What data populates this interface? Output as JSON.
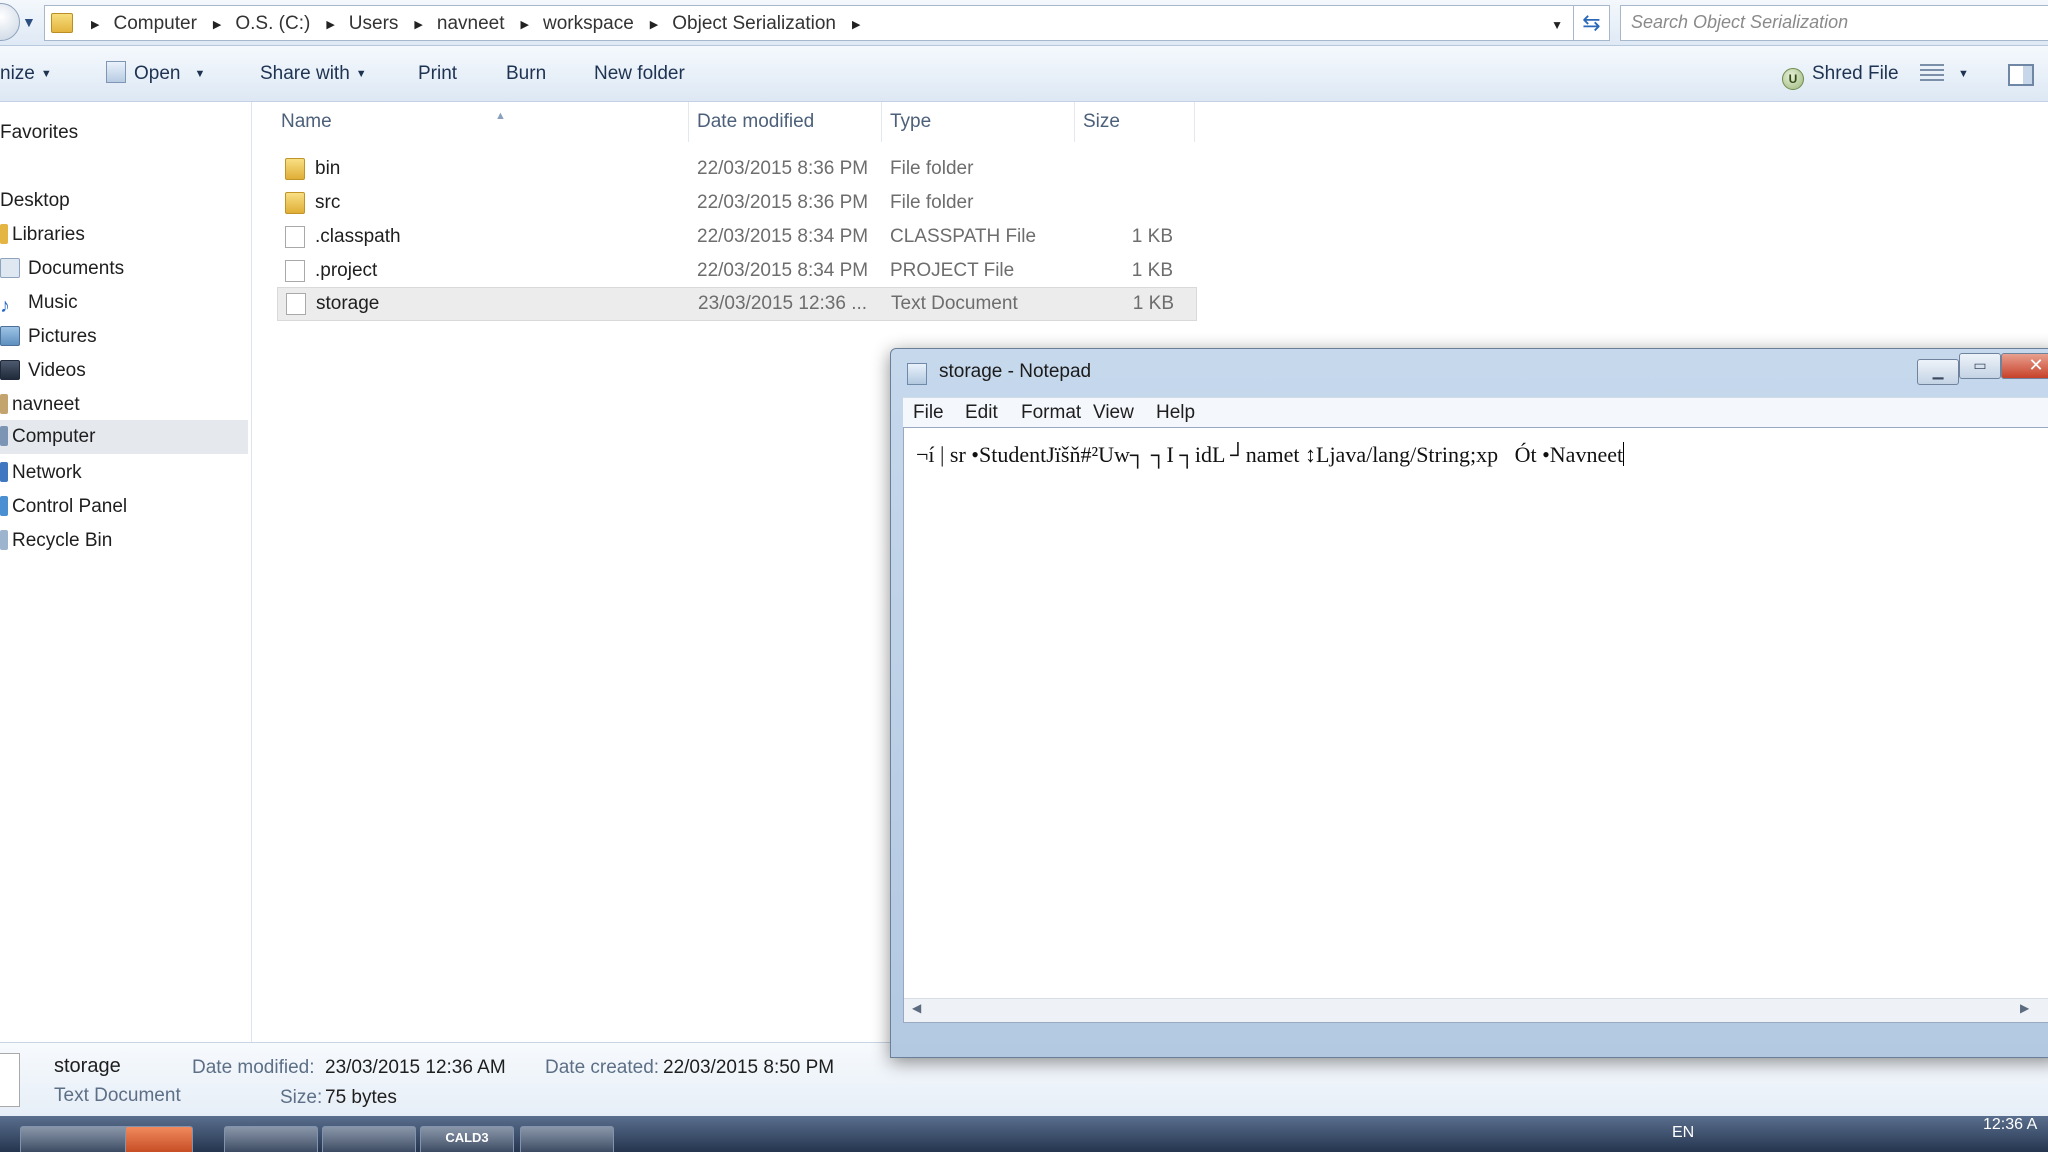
{
  "address_bar": {
    "breadcrumbs": [
      "Computer",
      "O.S. (C:)",
      "Users",
      "navneet",
      "workspace",
      "Object Serialization"
    ],
    "search_placeholder": "Search Object Serialization"
  },
  "toolbar": {
    "organize": "nize",
    "open": "Open",
    "share_with": "Share with",
    "print": "Print",
    "burn": "Burn",
    "new_folder": "New folder",
    "shred_file": "Shred File"
  },
  "nav_pane": {
    "favorites": "Favorites",
    "desktop": "Desktop",
    "libraries": "Libraries",
    "documents": "Documents",
    "music": "Music",
    "pictures": "Pictures",
    "videos": "Videos",
    "navneet": "navneet",
    "computer": "Computer",
    "network": "Network",
    "control_panel": "Control Panel",
    "recycle_bin": "Recycle Bin"
  },
  "file_list": {
    "columns": {
      "name": "Name",
      "date_modified": "Date modified",
      "type": "Type",
      "size": "Size"
    },
    "rows": [
      {
        "name": "bin",
        "date": "22/03/2015 8:36 PM",
        "type": "File folder",
        "size": "",
        "icon": "folder-icon"
      },
      {
        "name": "src",
        "date": "22/03/2015 8:36 PM",
        "type": "File folder",
        "size": "",
        "icon": "folder-icon"
      },
      {
        "name": ".classpath",
        "date": "22/03/2015 8:34 PM",
        "type": "CLASSPATH File",
        "size": "1 KB",
        "icon": "file-icon"
      },
      {
        "name": ".project",
        "date": "22/03/2015 8:34 PM",
        "type": "PROJECT File",
        "size": "1 KB",
        "icon": "file-icon"
      },
      {
        "name": "storage",
        "date": "23/03/2015 12:36 ...",
        "type": "Text Document",
        "size": "1 KB",
        "icon": "text-file-icon"
      }
    ]
  },
  "details_pane": {
    "name": "storage",
    "kind": "Text Document",
    "date_modified_label": "Date modified:",
    "date_modified": "23/03/2015 12:36 AM",
    "date_created_label": "Date created:",
    "date_created": "22/03/2015 8:50 PM",
    "size_label": "Size:",
    "size": "75 bytes"
  },
  "notepad": {
    "title": "storage - Notepad",
    "menu": {
      "file": "File",
      "edit": "Edit",
      "format": "Format",
      "view": "View",
      "help": "Help"
    },
    "content": "¬í | sr •StudentJïšň#²Uw┐ ┐I ┐idL ┘namet ↕Ljava/lang/String;xp   Ót •Navneet"
  },
  "taskbar": {
    "app_badge": "CALD3",
    "tray_language": "EN",
    "clock": "12:36 A"
  }
}
